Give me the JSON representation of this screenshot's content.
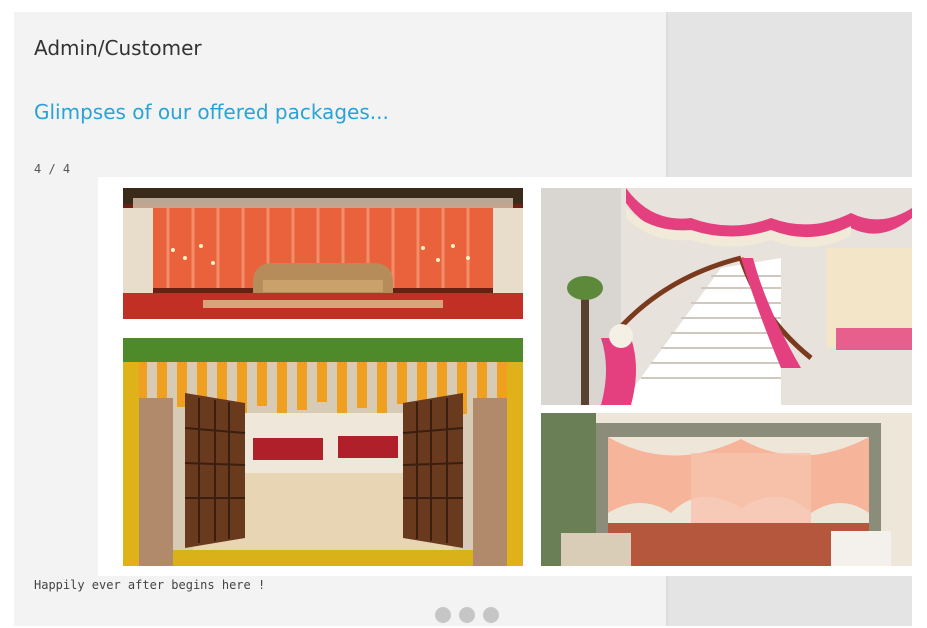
{
  "header": {
    "title": "Admin/Customer",
    "subtitle": "Glimpses of our offered packages..."
  },
  "slideshow": {
    "counter": "4 / 4",
    "caption": "Happily ever after begins here !",
    "dots": 3,
    "photos": [
      {
        "name": "stage-decor-photo"
      },
      {
        "name": "staircase-drapes-photo"
      },
      {
        "name": "marigold-doorway-photo"
      },
      {
        "name": "floral-arch-entrance-photo"
      }
    ]
  },
  "colors": {
    "accent": "#29a3d6",
    "card_background": "#f3f3f3",
    "side_panel": "#e4e4e4",
    "dot": "#c6c6c6"
  }
}
